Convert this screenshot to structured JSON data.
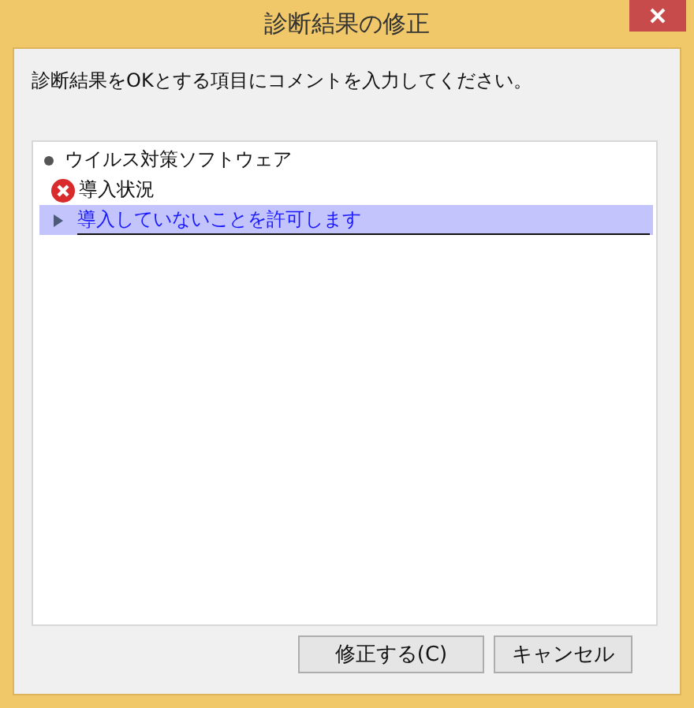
{
  "window": {
    "title": "診断結果の修正"
  },
  "instruction": "診断結果をOKとする項目にコメントを入力してください。",
  "tree": [
    {
      "kind": "category",
      "label": "ウイルス対策ソフトウェア",
      "children": [
        {
          "kind": "check",
          "passed": false,
          "label": "導入状況",
          "children": [
            {
              "kind": "comment",
              "value": "導入していないことを許可します",
              "selected": true
            }
          ]
        }
      ]
    }
  ],
  "buttons": [
    "修正する(C)",
    "キャンセル"
  ]
}
